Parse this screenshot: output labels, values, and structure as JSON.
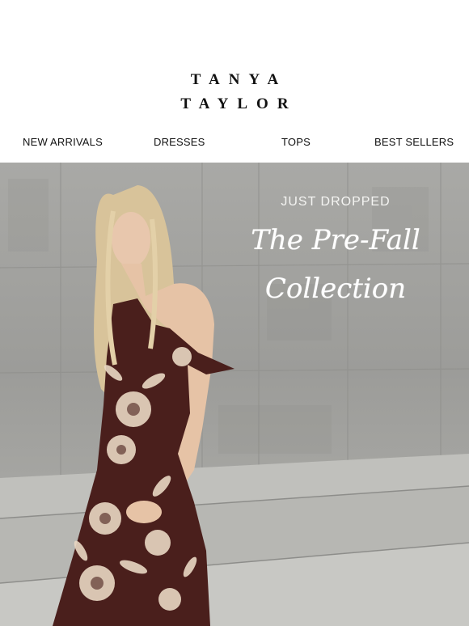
{
  "brand": {
    "line1": "TANYA",
    "line2": "TAYLOR"
  },
  "nav": {
    "items": [
      {
        "label": "NEW ARRIVALS"
      },
      {
        "label": "DRESSES"
      },
      {
        "label": "TOPS"
      },
      {
        "label": "BEST SELLERS"
      }
    ]
  },
  "hero": {
    "kicker": "JUST DROPPED",
    "title_line1": "The Pre-Fall",
    "title_line2": "Collection"
  },
  "colors": {
    "dress": "#4a1f1c",
    "floral": "#e9d7c3",
    "concrete": "#a6a6a3",
    "text_white": "#ffffff"
  }
}
